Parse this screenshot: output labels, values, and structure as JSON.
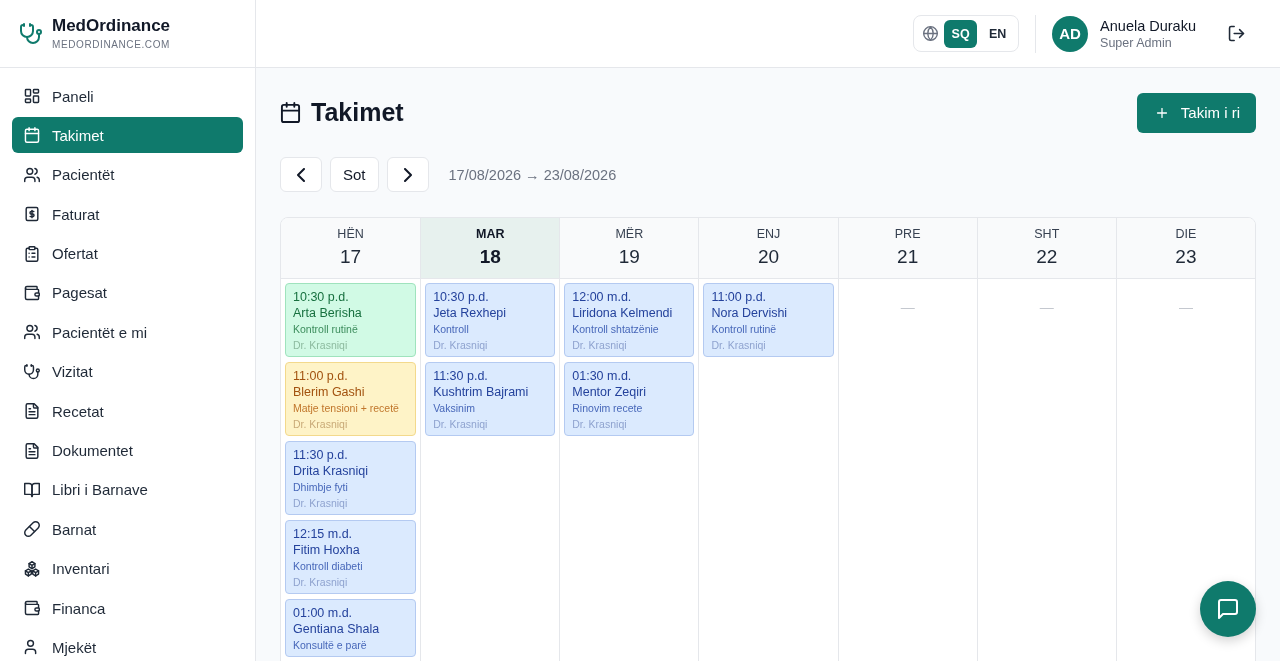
{
  "sidebar": {
    "brand": {
      "name": "MedOrdinance",
      "domain": "MEDORDINANCE.COM"
    },
    "items": [
      {
        "label": "Paneli",
        "selected": false
      },
      {
        "label": "Takimet",
        "selected": true
      },
      {
        "label": "Pacientët",
        "selected": false
      },
      {
        "label": "Faturat",
        "selected": false
      },
      {
        "label": "Ofertat",
        "selected": false
      },
      {
        "label": "Pagesat",
        "selected": false
      },
      {
        "label": "Pacientët e mi",
        "selected": false
      },
      {
        "label": "Vizitat",
        "selected": false
      },
      {
        "label": "Recetat",
        "selected": false
      },
      {
        "label": "Dokumentet",
        "selected": false
      },
      {
        "label": "Libri i Barnave",
        "selected": false
      },
      {
        "label": "Barnat",
        "selected": false
      },
      {
        "label": "Inventari",
        "selected": false
      },
      {
        "label": "Financa",
        "selected": false
      },
      {
        "label": "Mjekët",
        "selected": false
      }
    ]
  },
  "header": {
    "languages": [
      {
        "label": "SQ",
        "selected": true
      },
      {
        "label": "EN",
        "selected": false
      }
    ],
    "user": {
      "initials": "AD",
      "name": "Anuela Duraku",
      "role": "Super Admin"
    }
  },
  "page": {
    "title": "Takimet",
    "new_button": "Takim i ri"
  },
  "toolbar": {
    "today_button": "Sot",
    "range": "17/08/2026 → 23/08/2026"
  },
  "calendar": {
    "days": [
      {
        "weekday": "HËN",
        "date": "17",
        "today": false,
        "appointments": [
          {
            "time": "10:30 p.d.",
            "patient": "Arta Berisha",
            "reason": "Kontroll rutinë",
            "doctor": "Dr. Krasniqi",
            "color": "#d1fae5"
          },
          {
            "time": "11:00 p.d.",
            "patient": "Blerim Gashi",
            "reason": "Matje tensioni + recetë",
            "doctor": "Dr. Krasniqi",
            "color": "#fef3c7"
          },
          {
            "time": "11:30 p.d.",
            "patient": "Drita Krasniqi",
            "reason": "Dhimbje fyti",
            "doctor": "Dr. Krasniqi",
            "color": "#dbeafe"
          },
          {
            "time": "12:15 m.d.",
            "patient": "Fitim Hoxha",
            "reason": "Kontroll diabeti",
            "doctor": "Dr. Krasniqi",
            "color": "#dbeafe"
          },
          {
            "time": "01:00 m.d.",
            "patient": "Gentiana Shala",
            "reason": "Konsultë e parë",
            "color": "#dbeafe"
          }
        ]
      },
      {
        "weekday": "MAR",
        "date": "18",
        "today": true,
        "appointments": [
          {
            "time": "10:30 p.d.",
            "patient": "Jeta Rexhepi",
            "reason": "Kontroll",
            "doctor": "Dr. Krasniqi",
            "color": "#dbeafe"
          },
          {
            "time": "11:30 p.d.",
            "patient": "Kushtrim Bajrami",
            "reason": "Vaksinim",
            "doctor": "Dr. Krasniqi",
            "color": "#dbeafe"
          }
        ]
      },
      {
        "weekday": "MËR",
        "date": "19",
        "today": false,
        "appointments": [
          {
            "time": "12:00 m.d.",
            "patient": "Liridona Kelmendi",
            "reason": "Kontroll shtatzënie",
            "doctor": "Dr. Krasniqi",
            "color": "#dbeafe"
          },
          {
            "time": "01:30 m.d.",
            "patient": "Mentor Zeqiri",
            "reason": "Rinovim recete",
            "doctor": "Dr. Krasniqi",
            "color": "#dbeafe"
          }
        ]
      },
      {
        "weekday": "ENJ",
        "date": "20",
        "today": false,
        "appointments": [
          {
            "time": "11:00 p.d.",
            "patient": "Nora Dervishi",
            "reason": "Kontroll rutinë",
            "doctor": "Dr. Krasniqi",
            "color": "#dbeafe"
          }
        ]
      },
      {
        "weekday": "PRE",
        "date": "21",
        "today": false,
        "empty_label": "—"
      },
      {
        "weekday": "SHT",
        "date": "22",
        "today": false,
        "empty_label": "—"
      },
      {
        "weekday": "DIE",
        "date": "23",
        "today": false,
        "empty_label": "—"
      }
    ]
  }
}
